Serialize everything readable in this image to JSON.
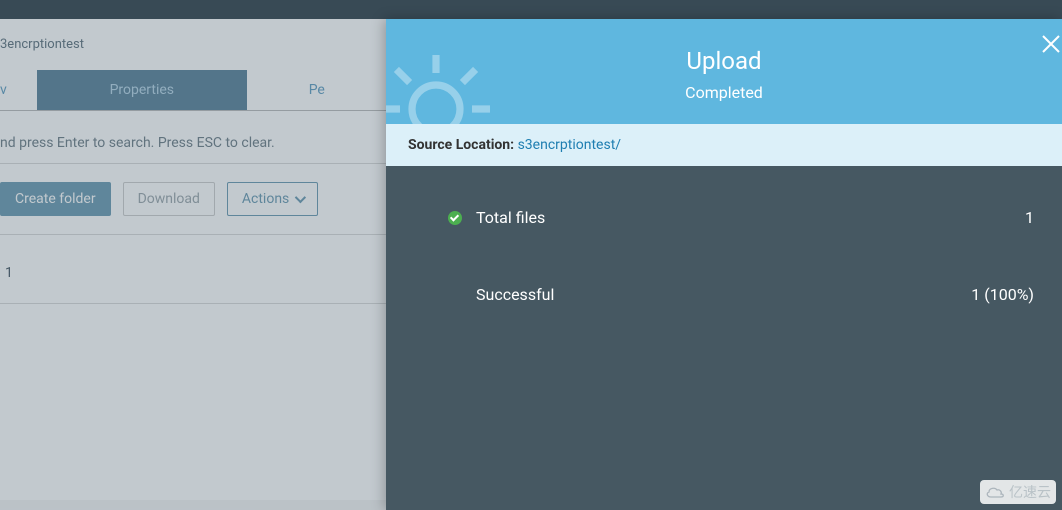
{
  "breadcrumb": "3encrptiontest",
  "tabs": {
    "overview": "v",
    "properties": "Properties",
    "permissions": "Pe"
  },
  "search": {
    "placeholder": "nd press Enter to search. Press ESC to clear."
  },
  "buttons": {
    "create_folder": "Create folder",
    "download": "Download",
    "actions": "Actions"
  },
  "table": {
    "row1": "1"
  },
  "panel": {
    "title": "Upload",
    "subtitle": "Completed",
    "source_label": "Source Location:",
    "source_value": "s3encrptiontest/",
    "stats": {
      "total_label": "Total files",
      "total_value": "1",
      "successful_label": "Successful",
      "successful_value": "1 (100%)"
    }
  },
  "watermark": "亿速云"
}
